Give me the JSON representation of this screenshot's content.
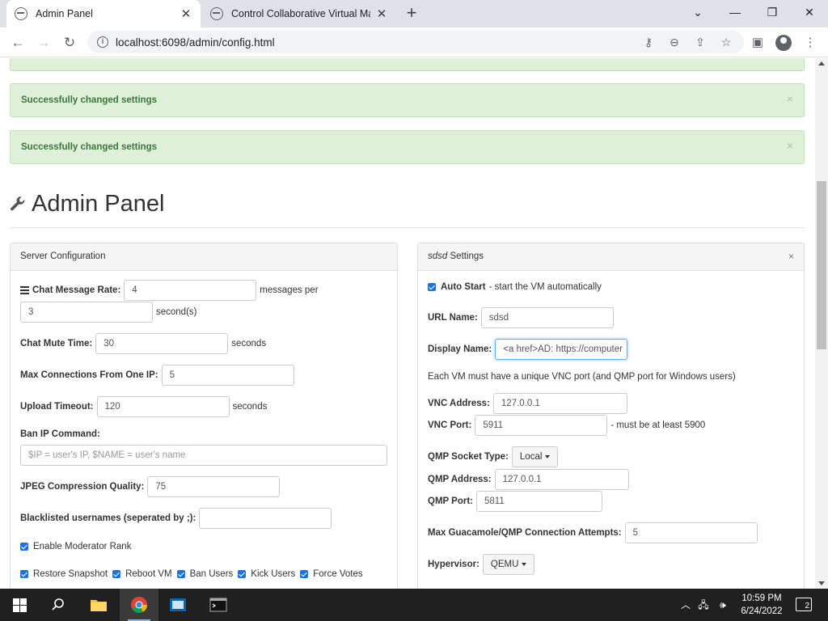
{
  "browser": {
    "tabs": [
      {
        "title": "Admin Panel",
        "active": true
      },
      {
        "title": "Control Collaborative Virtual Mac",
        "active": false
      }
    ],
    "url": "localhost:6098/admin/config.html"
  },
  "alerts": [
    {
      "text": "Successfully changed settings"
    },
    {
      "text": "Successfully changed settings"
    }
  ],
  "page": {
    "title": "Admin Panel"
  },
  "server_config": {
    "heading": "Server Configuration",
    "chat_message_rate": {
      "label": "Chat Message Rate:",
      "value": "4",
      "suffix": "messages per",
      "per_value": "3",
      "per_suffix": "second(s)"
    },
    "chat_mute_time": {
      "label": "Chat Mute Time:",
      "value": "30",
      "suffix": "seconds"
    },
    "max_connections": {
      "label": "Max Connections From One IP:",
      "value": "5"
    },
    "upload_timeout": {
      "label": "Upload Timeout:",
      "value": "120",
      "suffix": "seconds"
    },
    "ban_ip_command": {
      "label": "Ban IP Command:",
      "placeholder": "$IP = user's IP, $NAME = user's name",
      "value": ""
    },
    "jpeg_quality": {
      "label": "JPEG Compression Quality:",
      "value": "75"
    },
    "blacklisted_usernames": {
      "label": "Blacklisted usernames (seperated by ;):",
      "value": ""
    },
    "enable_moderator_rank": {
      "label": "Enable Moderator Rank",
      "checked": true
    },
    "moderator_permissions": [
      {
        "label": "Restore Snapshot",
        "checked": true
      },
      {
        "label": "Reboot VM",
        "checked": true
      },
      {
        "label": "Ban Users",
        "checked": true
      },
      {
        "label": "Kick Users",
        "checked": true
      },
      {
        "label": "Force Votes",
        "checked": true
      }
    ]
  },
  "vm_settings": {
    "vm_name": "sdsd",
    "heading_suffix": "Settings",
    "close_label": "×",
    "auto_start": {
      "label": "Auto Start",
      "description": "- start the VM automatically",
      "checked": true
    },
    "url_name": {
      "label": "URL Name:",
      "value": "sdsd"
    },
    "display_name": {
      "label": "Display Name:",
      "value": "<a href>AD: https://computer"
    },
    "vnc_note": "Each VM must have a unique VNC port (and QMP port for Windows users)",
    "vnc_address": {
      "label": "VNC Address:",
      "value": "127.0.0.1"
    },
    "vnc_port": {
      "label": "VNC Port:",
      "value": "5911",
      "suffix": "- must be at least 5900"
    },
    "qmp_socket_type": {
      "label": "QMP Socket Type:",
      "value": "Local"
    },
    "qmp_address": {
      "label": "QMP Address:",
      "value": "127.0.0.1"
    },
    "qmp_port": {
      "label": "QMP Port:",
      "value": "5811"
    },
    "max_attempts": {
      "label": "Max Guacamole/QMP Connection Attempts:",
      "value": "5"
    },
    "hypervisor": {
      "label": "Hypervisor:",
      "value": "QEMU"
    }
  },
  "taskbar": {
    "time": "10:59 PM",
    "date": "6/24/2022",
    "notification_count": "2"
  },
  "colors": {
    "alert_bg": "#dff0d8",
    "alert_text": "#3c763d",
    "checkbox": "#1a73e8",
    "focus": "#66afe9"
  }
}
